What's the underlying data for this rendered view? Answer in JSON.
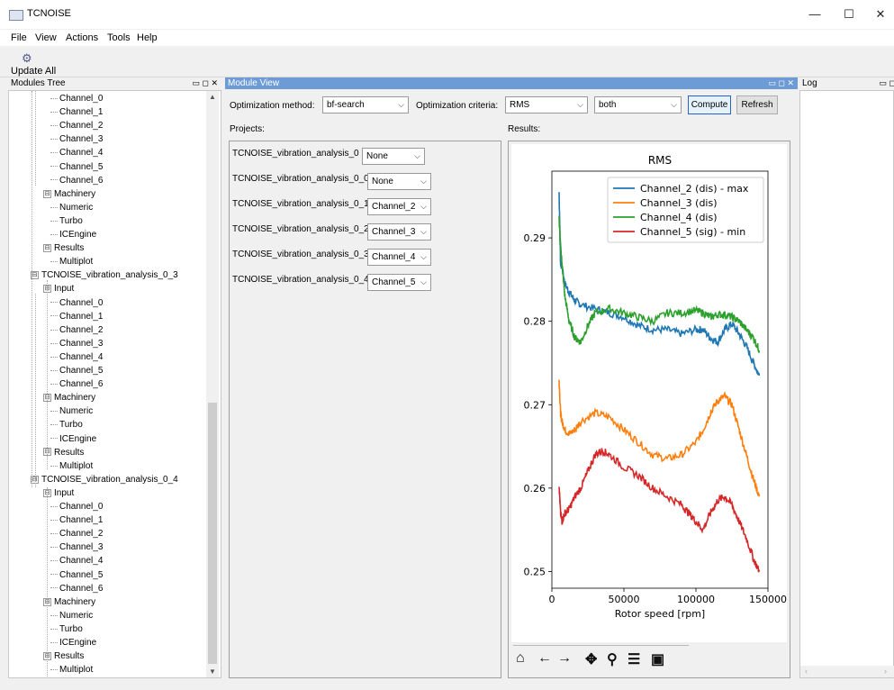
{
  "window": {
    "title": "TCNOISE",
    "minimize": "—",
    "maximize": "☐",
    "close": "✕"
  },
  "menu": [
    "File",
    "View",
    "Actions",
    "Tools",
    "Help"
  ],
  "toolbar": {
    "update_label": "Update All",
    "update_icon": "gear-icon"
  },
  "panels": {
    "modules_tree": "Modules Tree",
    "module_view": "Module View",
    "log": "Log",
    "dock_buttons": "▭ ◻ ✕"
  },
  "tree": [
    {
      "label": "Channel_0",
      "level": 3
    },
    {
      "label": "Channel_1",
      "level": 3
    },
    {
      "label": "Channel_2",
      "level": 3
    },
    {
      "label": "Channel_3",
      "level": 3
    },
    {
      "label": "Channel_4",
      "level": 3
    },
    {
      "label": "Channel_5",
      "level": 3
    },
    {
      "label": "Channel_6",
      "level": 3
    },
    {
      "label": "Machinery",
      "level": 2,
      "expander": "⊟"
    },
    {
      "label": "Numeric",
      "level": 3
    },
    {
      "label": "Turbo",
      "level": 3
    },
    {
      "label": "ICEngine",
      "level": 3
    },
    {
      "label": "Results",
      "level": 2,
      "expander": "⊟"
    },
    {
      "label": "Multiplot",
      "level": 3
    },
    {
      "label": "TCNOISE_vibration_analysis_0_3",
      "level": 1,
      "expander": "⊟"
    },
    {
      "label": "Input",
      "level": 2,
      "expander": "⊟"
    },
    {
      "label": "Channel_0",
      "level": 3
    },
    {
      "label": "Channel_1",
      "level": 3
    },
    {
      "label": "Channel_2",
      "level": 3
    },
    {
      "label": "Channel_3",
      "level": 3
    },
    {
      "label": "Channel_4",
      "level": 3
    },
    {
      "label": "Channel_5",
      "level": 3
    },
    {
      "label": "Channel_6",
      "level": 3
    },
    {
      "label": "Machinery",
      "level": 2,
      "expander": "⊟"
    },
    {
      "label": "Numeric",
      "level": 3
    },
    {
      "label": "Turbo",
      "level": 3
    },
    {
      "label": "ICEngine",
      "level": 3
    },
    {
      "label": "Results",
      "level": 2,
      "expander": "⊟"
    },
    {
      "label": "Multiplot",
      "level": 3
    },
    {
      "label": "TCNOISE_vibration_analysis_0_4",
      "level": 1,
      "expander": "⊟"
    },
    {
      "label": "Input",
      "level": 2,
      "expander": "⊟"
    },
    {
      "label": "Channel_0",
      "level": 3
    },
    {
      "label": "Channel_1",
      "level": 3
    },
    {
      "label": "Channel_2",
      "level": 3
    },
    {
      "label": "Channel_3",
      "level": 3
    },
    {
      "label": "Channel_4",
      "level": 3
    },
    {
      "label": "Channel_5",
      "level": 3
    },
    {
      "label": "Channel_6",
      "level": 3
    },
    {
      "label": "Machinery",
      "level": 2,
      "expander": "⊟"
    },
    {
      "label": "Numeric",
      "level": 3
    },
    {
      "label": "Turbo",
      "level": 3
    },
    {
      "label": "ICEngine",
      "level": 3
    },
    {
      "label": "Results",
      "level": 2,
      "expander": "⊟"
    },
    {
      "label": "Multiplot",
      "level": 3
    }
  ],
  "controls": {
    "opt_method_label": "Optimization method:",
    "opt_method_value": "bf-search",
    "opt_criteria_label": "Optimization criteria:",
    "opt_criteria_value": "RMS",
    "mode_value": "both",
    "compute": "Compute",
    "refresh": "Refresh",
    "projects_label": "Projects:",
    "results_label": "Results:",
    "dropdown_arrow": "⌵"
  },
  "projects": [
    {
      "name": "TCNOISE_vibration_analysis_0",
      "value": "None"
    },
    {
      "name": "TCNOISE_vibration_analysis_0_0",
      "value": "None"
    },
    {
      "name": "TCNOISE_vibration_analysis_0_1",
      "value": "Channel_2"
    },
    {
      "name": "TCNOISE_vibration_analysis_0_2",
      "value": "Channel_3"
    },
    {
      "name": "TCNOISE_vibration_analysis_0_3",
      "value": "Channel_4"
    },
    {
      "name": "TCNOISE_vibration_analysis_0_4",
      "value": "Channel_5"
    }
  ],
  "plot_toolbar": [
    {
      "icon": "home-icon",
      "glyph": "⌂"
    },
    {
      "icon": "back-arrow-icon",
      "glyph": "←"
    },
    {
      "icon": "forward-arrow-icon",
      "glyph": "→"
    },
    {
      "icon": "pan-icon",
      "glyph": "✥"
    },
    {
      "icon": "zoom-icon",
      "glyph": "⚲"
    },
    {
      "icon": "configure-icon",
      "glyph": "☰"
    },
    {
      "icon": "save-icon",
      "glyph": "▣"
    }
  ],
  "chart_data": {
    "type": "line",
    "title": "RMS",
    "xlabel": "Rotor speed [rpm]",
    "ylabel": "",
    "xlim": [
      0,
      150000
    ],
    "ylim": [
      0.248,
      0.298
    ],
    "xticks": [
      0,
      50000,
      100000,
      150000
    ],
    "yticks": [
      0.25,
      0.26,
      0.27,
      0.28,
      0.29
    ],
    "grid": false,
    "legend_position": "top-right",
    "series": [
      {
        "name": "Channel_2 (dis) - max",
        "color": "#1f77b4",
        "x": [
          5000,
          6000,
          7000,
          9000,
          12000,
          16000,
          20000,
          30000,
          40000,
          50000,
          60000,
          70000,
          80000,
          90000,
          100000,
          105000,
          110000,
          115000,
          120000,
          125000,
          130000,
          135000,
          140000,
          144000
        ],
        "y": [
          0.2955,
          0.287,
          0.2865,
          0.2845,
          0.2835,
          0.2825,
          0.282,
          0.2815,
          0.281,
          0.2805,
          0.2795,
          0.279,
          0.279,
          0.2785,
          0.279,
          0.279,
          0.278,
          0.2775,
          0.279,
          0.2797,
          0.2785,
          0.277,
          0.275,
          0.2735
        ]
      },
      {
        "name": "Channel_3 (dis)",
        "color": "#ff7f0e",
        "x": [
          5000,
          6000,
          7000,
          9000,
          12000,
          16000,
          20000,
          30000,
          40000,
          50000,
          60000,
          70000,
          80000,
          90000,
          100000,
          105000,
          110000,
          115000,
          120000,
          125000,
          130000,
          135000,
          140000,
          144000
        ],
        "y": [
          0.273,
          0.269,
          0.268,
          0.267,
          0.2665,
          0.267,
          0.268,
          0.269,
          0.2685,
          0.267,
          0.2655,
          0.264,
          0.2635,
          0.264,
          0.2655,
          0.267,
          0.269,
          0.2705,
          0.271,
          0.27,
          0.267,
          0.264,
          0.261,
          0.259
        ]
      },
      {
        "name": "Channel_4 (dis)",
        "color": "#2ca02c",
        "x": [
          5000,
          6000,
          7000,
          9000,
          12000,
          16000,
          20000,
          25000,
          30000,
          40000,
          50000,
          60000,
          70000,
          80000,
          90000,
          100000,
          105000,
          110000,
          115000,
          120000,
          125000,
          130000,
          135000,
          140000,
          144000
        ],
        "y": [
          0.2925,
          0.289,
          0.287,
          0.283,
          0.28,
          0.278,
          0.2775,
          0.2795,
          0.281,
          0.2815,
          0.281,
          0.2805,
          0.28,
          0.281,
          0.281,
          0.2813,
          0.281,
          0.2805,
          0.2808,
          0.2808,
          0.2805,
          0.28,
          0.279,
          0.278,
          0.2765
        ]
      },
      {
        "name": "Channel_5 (sig) - min",
        "color": "#d62728",
        "x": [
          5000,
          6000,
          7000,
          9000,
          12000,
          16000,
          20000,
          25000,
          30000,
          35000,
          40000,
          50000,
          60000,
          70000,
          80000,
          90000,
          95000,
          100000,
          105000,
          110000,
          115000,
          120000,
          125000,
          130000,
          135000,
          140000,
          144000
        ],
        "y": [
          0.2605,
          0.257,
          0.256,
          0.257,
          0.2575,
          0.259,
          0.26,
          0.262,
          0.264,
          0.2645,
          0.264,
          0.2625,
          0.2615,
          0.26,
          0.259,
          0.258,
          0.257,
          0.256,
          0.255,
          0.257,
          0.2585,
          0.259,
          0.258,
          0.256,
          0.254,
          0.2515,
          0.25
        ]
      }
    ]
  }
}
